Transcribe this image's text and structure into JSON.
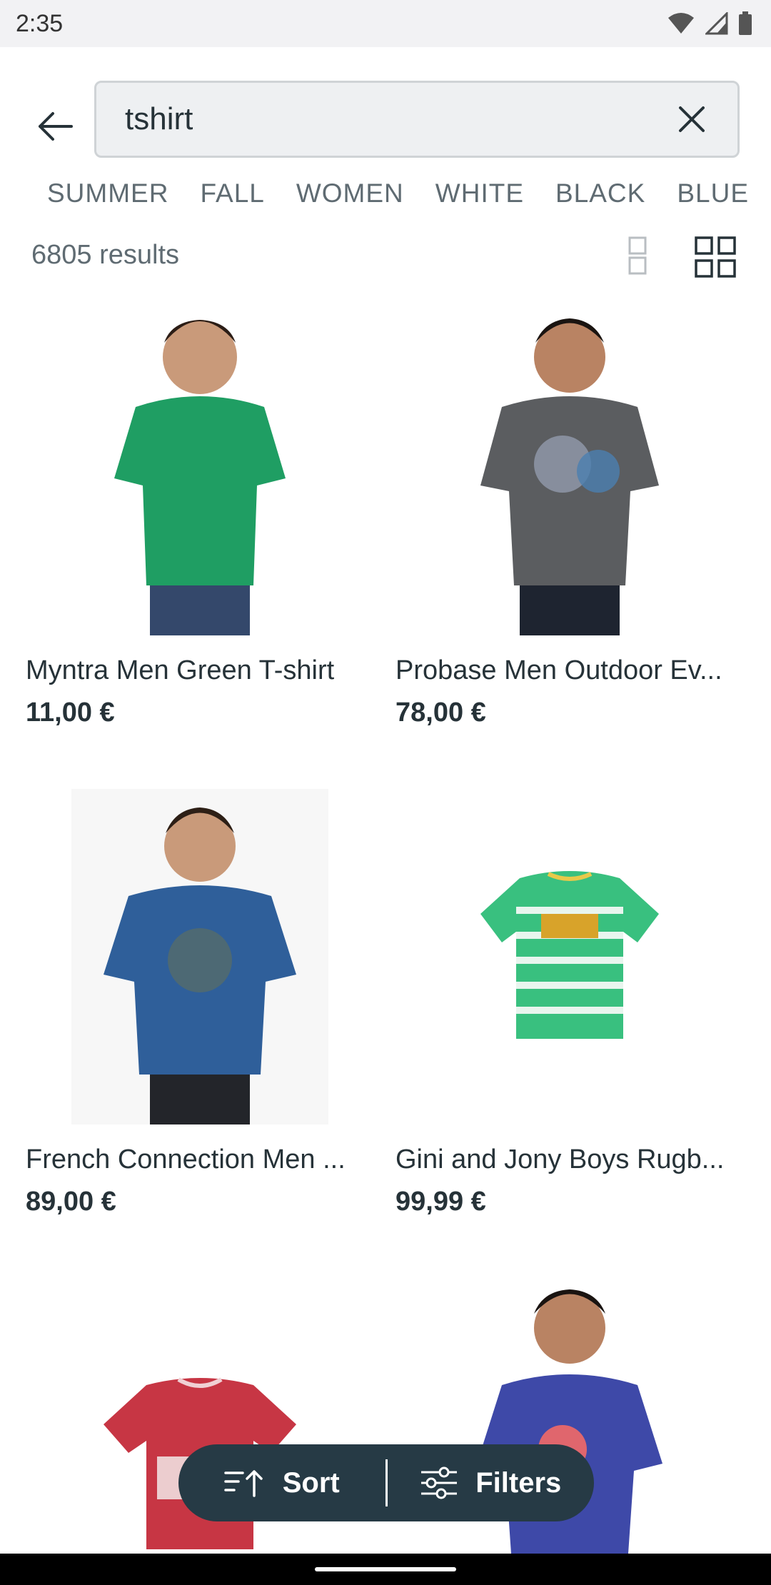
{
  "status": {
    "time": "2:35"
  },
  "search": {
    "query": "tshirt"
  },
  "tags": [
    "SUMMER",
    "FALL",
    "WOMEN",
    "WHITE",
    "BLACK",
    "BLUE"
  ],
  "results": {
    "count_label": "6805 results"
  },
  "products": [
    {
      "name": "Myntra Men Green T-shirt",
      "price": "11,00 €",
      "shirt_color": "#1f9e63"
    },
    {
      "name": "Probase Men Outdoor Ev...",
      "price": "78,00 €",
      "shirt_color": "#5b5d60"
    },
    {
      "name": "French Connection Men ...",
      "price": "89,00 €",
      "shirt_color": "#2f5f9a"
    },
    {
      "name": "Gini and Jony Boys Rugb...",
      "price": "99,99 €",
      "shirt_color": "#39c07f"
    },
    {
      "name": "",
      "price": "",
      "shirt_color": "#c73644"
    },
    {
      "name": "",
      "price": "",
      "shirt_color": "#3e49a8"
    }
  ],
  "actions": {
    "sort_label": "Sort",
    "filters_label": "Filters"
  },
  "colors": {
    "pill_bg": "#263a45",
    "text": "#263238",
    "muted": "#5f6b72"
  }
}
